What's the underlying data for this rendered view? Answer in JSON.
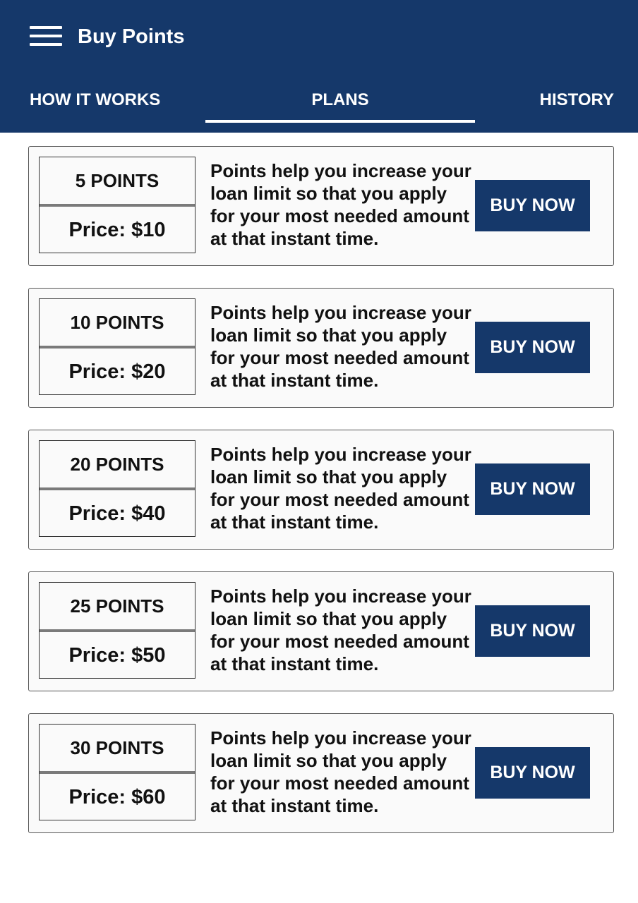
{
  "header": {
    "menu_icon": "hamburger-menu-icon",
    "title": "Buy Points"
  },
  "tabs": [
    {
      "label": "HOW IT WORKS",
      "active": false
    },
    {
      "label": "PLANS",
      "active": true
    },
    {
      "label": "HISTORY",
      "active": false
    }
  ],
  "colors": {
    "primary": "#15386a",
    "card_background": "#fafafa",
    "divider": "#7a7a7a"
  },
  "plans": [
    {
      "points": "5 POINTS",
      "price": "Price: $10",
      "description": "Points help you increase your loan limit so that you apply for your most needed amount at that instant time.",
      "button": "BUY NOW"
    },
    {
      "points": "10 POINTS",
      "price": "Price: $20",
      "description": "Points help you increase your loan limit so that you apply for your most needed amount at that instant time.",
      "button": "BUY NOW"
    },
    {
      "points": "20 POINTS",
      "price": "Price: $40",
      "description": "Points help you increase your loan limit so that you apply for your most needed amount at that instant time.",
      "button": "BUY NOW"
    },
    {
      "points": "25 POINTS",
      "price": "Price: $50",
      "description": "Points help you increase your loan limit so that you apply for your most needed amount at that instant time.",
      "button": "BUY NOW"
    },
    {
      "points": "30 POINTS",
      "price": "Price: $60",
      "description": "Points help you increase your loan limit so that you apply for your most needed amount at that instant time.",
      "button": "BUY NOW"
    }
  ]
}
